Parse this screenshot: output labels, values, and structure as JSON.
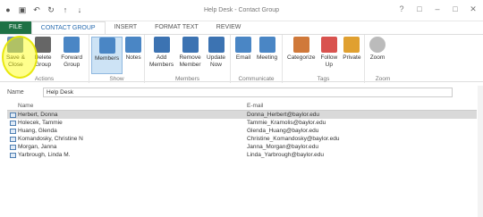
{
  "window": {
    "title": "Help Desk - Contact Group"
  },
  "ribbon_tabs": [
    "FILE",
    "CONTACT GROUP",
    "INSERT",
    "FORMAT TEXT",
    "REVIEW"
  ],
  "groups": {
    "actions": {
      "label": "Actions",
      "buttons": [
        "Save & Close",
        "Delete Group",
        "Forward Group"
      ]
    },
    "show": {
      "label": "Show",
      "buttons": [
        "Members",
        "Notes"
      ]
    },
    "members": {
      "label": "Members",
      "buttons": [
        "Add Members",
        "Remove Member",
        "Update Now"
      ]
    },
    "communicate": {
      "label": "Communicate",
      "buttons": [
        "Email",
        "Meeting"
      ]
    },
    "tags": {
      "label": "Tags",
      "buttons": [
        "Categorize",
        "Follow Up",
        "Private"
      ]
    },
    "zoom": {
      "label": "Zoom",
      "buttons": [
        "Zoom"
      ]
    }
  },
  "name_field": {
    "label": "Name",
    "value": "Help Desk"
  },
  "columns": {
    "name": "Name",
    "email": "E-mail"
  },
  "contacts": [
    {
      "name": "Herbert, Donna",
      "email": "Donna_Herbert@baylor.edu"
    },
    {
      "name": "Holecek, Tammie",
      "email": "Tammie_Kramolis@baylor.edu"
    },
    {
      "name": "Huang, Glenda",
      "email": "Glenda_Huang@baylor.edu"
    },
    {
      "name": "Komandosky, Christine N",
      "email": "Christine_Komandosky@baylor.edu"
    },
    {
      "name": "Morgan, Janna",
      "email": "Janna_Morgan@baylor.edu"
    },
    {
      "name": "Yarbrough, Linda M.",
      "email": "Linda_Yarbrough@baylor.edu"
    }
  ]
}
